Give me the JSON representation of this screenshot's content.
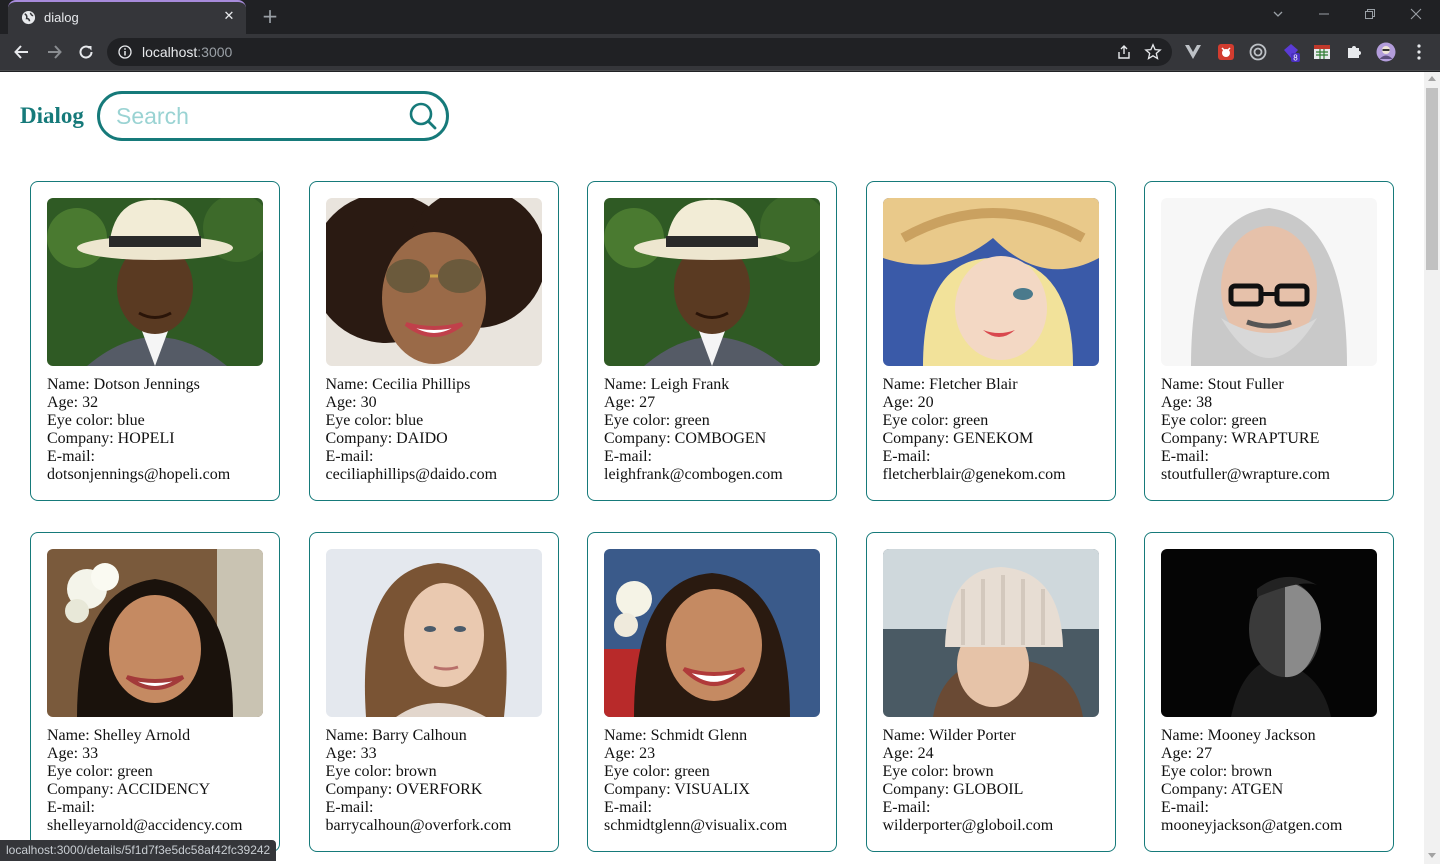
{
  "browser": {
    "tab_title": "dialog",
    "url_host": "localhost",
    "url_port": ":3000",
    "status_url": "localhost:3000/details/5f1d7f3e5dc58af42fc39242"
  },
  "header": {
    "brand": "Dialog",
    "search_placeholder": "Search",
    "accent_color": "#167a7a"
  },
  "labels": {
    "name": "Name: ",
    "age": "Age: ",
    "eye": "Eye color: ",
    "company": "Company: ",
    "email": "E-mail:"
  },
  "cards": [
    {
      "name": "Dotson Jennings",
      "age": "32",
      "eye": "blue",
      "company": "HOPELI",
      "email": "dotsonjennings@hopeli.com",
      "photo": "man-white-hat"
    },
    {
      "name": "Cecilia Phillips",
      "age": "30",
      "eye": "blue",
      "company": "DAIDO",
      "email": "ceciliaphillips@daido.com",
      "photo": "woman-aviator-sunglasses"
    },
    {
      "name": "Leigh Frank",
      "age": "27",
      "eye": "green",
      "company": "COMBOGEN",
      "email": "leighfrank@combogen.com",
      "photo": "man-white-hat"
    },
    {
      "name": "Fletcher Blair",
      "age": "20",
      "eye": "green",
      "company": "GENEKOM",
      "email": "fletcherblair@genekom.com",
      "photo": "blonde-woman-straw-hat"
    },
    {
      "name": "Stout Fuller",
      "age": "38",
      "eye": "green",
      "company": "WRAPTURE",
      "email": "stoutfuller@wrapture.com",
      "photo": "old-man-glasses"
    },
    {
      "name": "Shelley Arnold",
      "age": "33",
      "eye": "green",
      "company": "ACCIDENCY",
      "email": "shelleyarnold@accidency.com",
      "photo": "woman-flower-hair"
    },
    {
      "name": "Barry Calhoun",
      "age": "33",
      "eye": "brown",
      "company": "OVERFORK",
      "email": "barrycalhoun@overfork.com",
      "photo": "woman-long-hair"
    },
    {
      "name": "Schmidt Glenn",
      "age": "23",
      "eye": "green",
      "company": "VISUALIX",
      "email": "schmidtglenn@visualix.com",
      "photo": "woman-flower-smile"
    },
    {
      "name": "Wilder Porter",
      "age": "24",
      "eye": "brown",
      "company": "GLOBOIL",
      "email": "wilderporter@globoil.com",
      "photo": "woman-knit-beanie"
    },
    {
      "name": "Mooney Jackson",
      "age": "27",
      "eye": "brown",
      "company": "ATGEN",
      "email": "mooneyjackson@atgen.com",
      "photo": "man-dark-portrait"
    }
  ]
}
